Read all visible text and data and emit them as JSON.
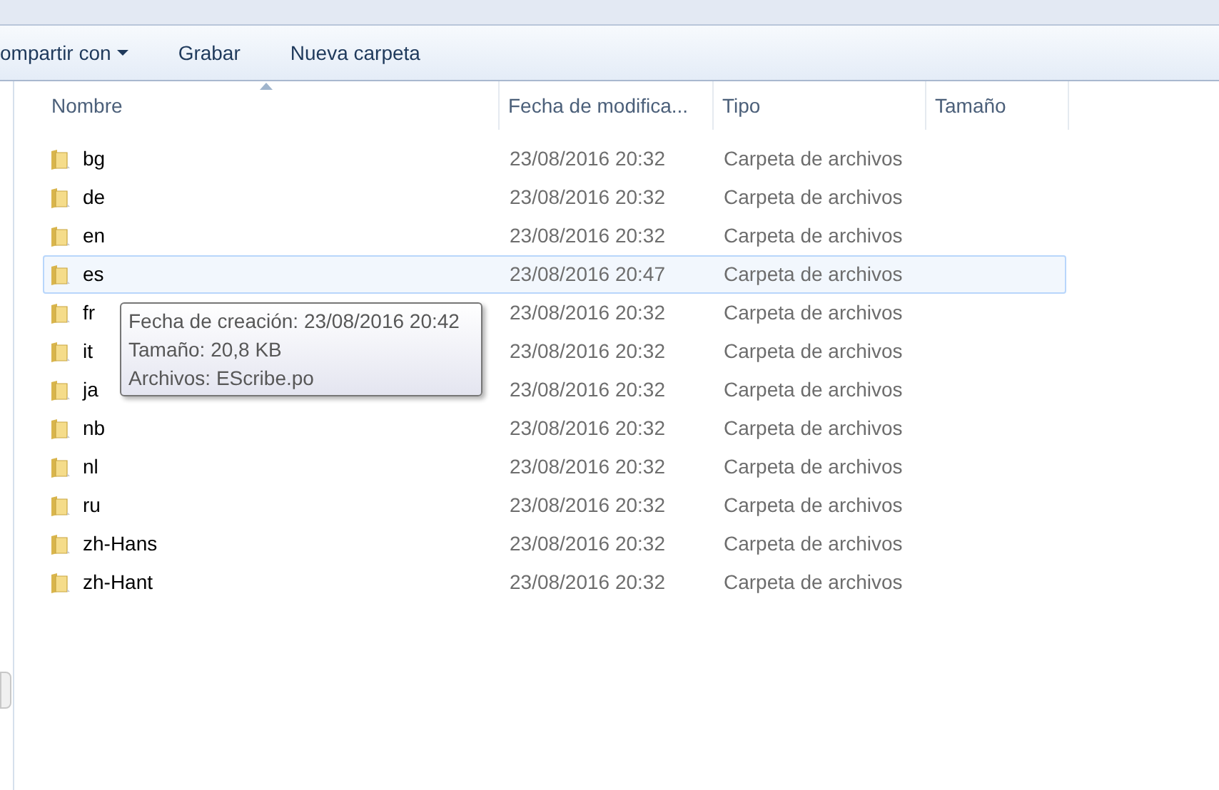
{
  "toolbar": {
    "items": [
      {
        "label": "ompartir con",
        "dropdown": true
      },
      {
        "label": "Grabar",
        "dropdown": false
      },
      {
        "label": "Nueva carpeta",
        "dropdown": false
      }
    ]
  },
  "table": {
    "columns": [
      {
        "label": "Nombre",
        "sorted": true
      },
      {
        "label": "Fecha de modifica...",
        "sorted": false
      },
      {
        "label": "Tipo",
        "sorted": false
      },
      {
        "label": "Tamaño",
        "sorted": false
      }
    ],
    "rows": [
      {
        "name": "bg",
        "modified": "23/08/2016 20:32",
        "type": "Carpeta de archivos",
        "hovered": false
      },
      {
        "name": "de",
        "modified": "23/08/2016 20:32",
        "type": "Carpeta de archivos",
        "hovered": false
      },
      {
        "name": "en",
        "modified": "23/08/2016 20:32",
        "type": "Carpeta de archivos",
        "hovered": false
      },
      {
        "name": "es",
        "modified": "23/08/2016 20:47",
        "type": "Carpeta de archivos",
        "hovered": true
      },
      {
        "name": "fr",
        "modified": "23/08/2016 20:32",
        "type": "Carpeta de archivos",
        "hovered": false
      },
      {
        "name": "it",
        "modified": "23/08/2016 20:32",
        "type": "Carpeta de archivos",
        "hovered": false
      },
      {
        "name": "ja",
        "modified": "23/08/2016 20:32",
        "type": "Carpeta de archivos",
        "hovered": false
      },
      {
        "name": "nb",
        "modified": "23/08/2016 20:32",
        "type": "Carpeta de archivos",
        "hovered": false
      },
      {
        "name": "nl",
        "modified": "23/08/2016 20:32",
        "type": "Carpeta de archivos",
        "hovered": false
      },
      {
        "name": "ru",
        "modified": "23/08/2016 20:32",
        "type": "Carpeta de archivos",
        "hovered": false
      },
      {
        "name": "zh-Hans",
        "modified": "23/08/2016 20:32",
        "type": "Carpeta de archivos",
        "hovered": false
      },
      {
        "name": "zh-Hant",
        "modified": "23/08/2016 20:32",
        "type": "Carpeta de archivos",
        "hovered": false
      }
    ]
  },
  "tooltip": {
    "lines": [
      "Fecha de creación: 23/08/2016 20:42",
      "Tamaño: 20,8 KB",
      "Archivos: EScribe.po"
    ]
  }
}
